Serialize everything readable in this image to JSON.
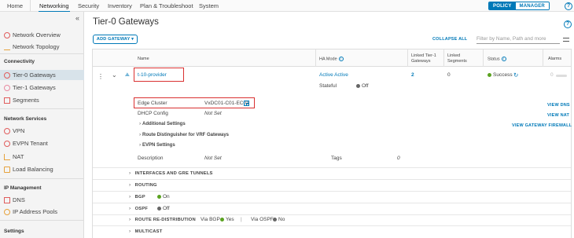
{
  "topnav": {
    "tabs": [
      "Home",
      "Networking",
      "Security",
      "Inventory",
      "Plan & Troubleshoot",
      "System"
    ],
    "active_tab": "Networking",
    "mode_policy": "POLICY",
    "mode_manager": "MANAGER",
    "help": "?"
  },
  "sidebar": {
    "collapse": "«",
    "items_top": [
      "Network Overview",
      "Network Topology"
    ],
    "section_connectivity": "Connectivity",
    "connectivity": [
      "Tier-0 Gateways",
      "Tier-1 Gateways",
      "Segments"
    ],
    "section_services": "Network Services",
    "services": [
      "VPN",
      "EVPN Tenant",
      "NAT",
      "Load Balancing"
    ],
    "section_ip": "IP Management",
    "ip": [
      "DNS",
      "IP Address Pools"
    ],
    "section_settings": "Settings"
  },
  "main": {
    "title": "Tier-0 Gateways",
    "help": "?",
    "add_gateway": "ADD GATEWAY ▾",
    "collapse_all": "COLLAPSE ALL",
    "filter_placeholder": "Filter by Name, Path and more"
  },
  "grid": {
    "headers": {
      "name": "Name",
      "ha_mode": "HA Mode",
      "linked_t1": "Linked Tier-1 Gateways",
      "linked_segments": "Linked Segments",
      "status": "Status",
      "alarms": "Alarms"
    },
    "row": {
      "menu": "⋮",
      "expand": "⌄",
      "name": "t-10-provider",
      "ha_mode": "Active Active",
      "stateful_label": "Stateful",
      "stateful_value": "Off",
      "linked_t1": "2",
      "linked_segments": "0",
      "status": "Success",
      "alarms": "0",
      "edge_cluster_label": "Edge Cluster",
      "edge_cluster_value": "VxDC01-C01-EC01",
      "dhcp_label": "DHCP Config",
      "dhcp_value": "Not Set",
      "additional_settings": "Additional Settings",
      "route_distinguisher": "Route Distinguisher for VRF Gateways",
      "evpn_settings": "EVPN Settings",
      "description_label": "Description",
      "description_value": "Not Set",
      "tags_label": "Tags",
      "tags_value": "0",
      "view_dns": "VIEW DNS",
      "view_nat": "VIEW NAT",
      "view_firewall": "VIEW GATEWAY FIREWALL"
    },
    "sections": {
      "interfaces": "INTERFACES AND GRE TUNNELS",
      "routing": "ROUTING",
      "bgp": "BGP",
      "bgp_value": "On",
      "ospf": "OSPF",
      "ospf_value": "Off",
      "route_redist": "ROUTE RE-DISTRIBUTION",
      "via_bgp": "Via BGP",
      "via_bgp_value": "Yes",
      "via_sep": "|",
      "via_ospf": "Via OSPF",
      "via_ospf_value": "No",
      "multicast": "MULTICAST"
    }
  },
  "colors": {
    "accent": "#0079b8",
    "success": "#5aa220",
    "highlight_box": "#d93131",
    "active_sidebar": "#d8e3ea"
  }
}
